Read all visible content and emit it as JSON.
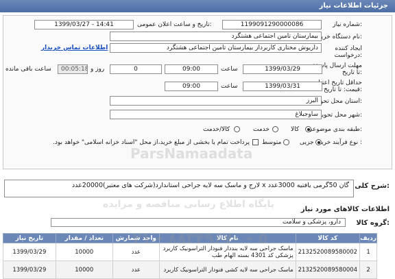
{
  "header": {
    "title": "جزئیات اطلاعات نیاز"
  },
  "form": {
    "need_number_label": "شماره نیاز:",
    "need_number": "1199091290000086",
    "announce_label": "تاریخ و ساعت اعلان عمومی:",
    "announce_value": "1399/03/27 - 14:41",
    "buyer_label": "نام دستگاه خریدار:",
    "buyer_value": "بیمارستان تامین اجتماعی هشتگرد",
    "creator_label": "ایجاد کننده درخواست:",
    "creator_value": "داریوش مختاری کاربرداز بیمارستان تامین اجتماعی هشتگرد",
    "contact_link": "اطلاعات تماس خریدار",
    "reply_deadline_label": "مهلت ارسال پاسخ: تا تاریخ:",
    "reply_date": "1399/03/29",
    "time_label": "ساعت",
    "reply_time": "09:00",
    "days_value": "0",
    "days_label": "روز و",
    "remaining_time": "00:05:18",
    "remaining_label": "ساعت باقی مانده",
    "price_deadline_label": "حداقل تاریخ اعتبار قیمت: تا تاریخ:",
    "price_date": "1399/03/31",
    "price_time": "09:00",
    "province_label": "استان محل تحویل:",
    "province_value": "البرز",
    "city_label": "شهر محل تحویل:",
    "city_value": "ساوجبلاغ",
    "category_label": "طبقه بندی موضوعی:",
    "category_options": [
      "کالا",
      "خدمت",
      "کالا/خدمت"
    ],
    "category_selected": 0,
    "process_label": "نوع فرآیند خرید :",
    "process_options": [
      "جزیی",
      "متوسط"
    ],
    "process_selected": 0,
    "payment_note": "پرداخت تمام یا بخشی از مبلغ خرید،از محل \"اسناد خزانه اسلامی\" خواهد بود."
  },
  "need": {
    "label": "شرح کلی نیاز:",
    "text": "گان 50گرمی یافتیه 3000عدد x لارج و ماسک سه لایه جراحی استاندارد(شرکت های معتبر)20000عدد"
  },
  "goods": {
    "title": "اطلاعات کالاهای مورد نیاز",
    "group_label": "گروه کالا:",
    "group_value": "دارو، پزشکی و سلامت",
    "columns": [
      "ردیف",
      "کد کالا",
      "نام کالا",
      "واحد شمارش",
      "تعداد / مقدار",
      "تاریخ نیاز"
    ],
    "rows": [
      {
        "index": "1",
        "code": "2132520089580002",
        "name": "ماسک جراحی سه لایه بنددار فنودار التراسونیک کاربرد پزشکی کد 4301 بسته الهام طب",
        "unit": "عدد",
        "qty": "10000",
        "date": "1399/03/29"
      },
      {
        "index": "2",
        "code": "2132520089580004",
        "name": "ماسک جراحی سه لایه کشی فنودار التراسونیک کاربرد",
        "unit": "عدد",
        "qty": "10000",
        "date": "1399/03/29"
      }
    ]
  },
  "watermark": {
    "brand": "ParsNamaadata",
    "line": "پایگاه اطلاع رسانی مناقصه و مزایده",
    "phone": "۰۲۱ - ۸۸۳۴۹۶۷۰ - ۵"
  },
  "colors": {
    "header_bg": "#4d6ea6",
    "link": "#1a4fc0",
    "table_header": "#6b87b8"
  }
}
